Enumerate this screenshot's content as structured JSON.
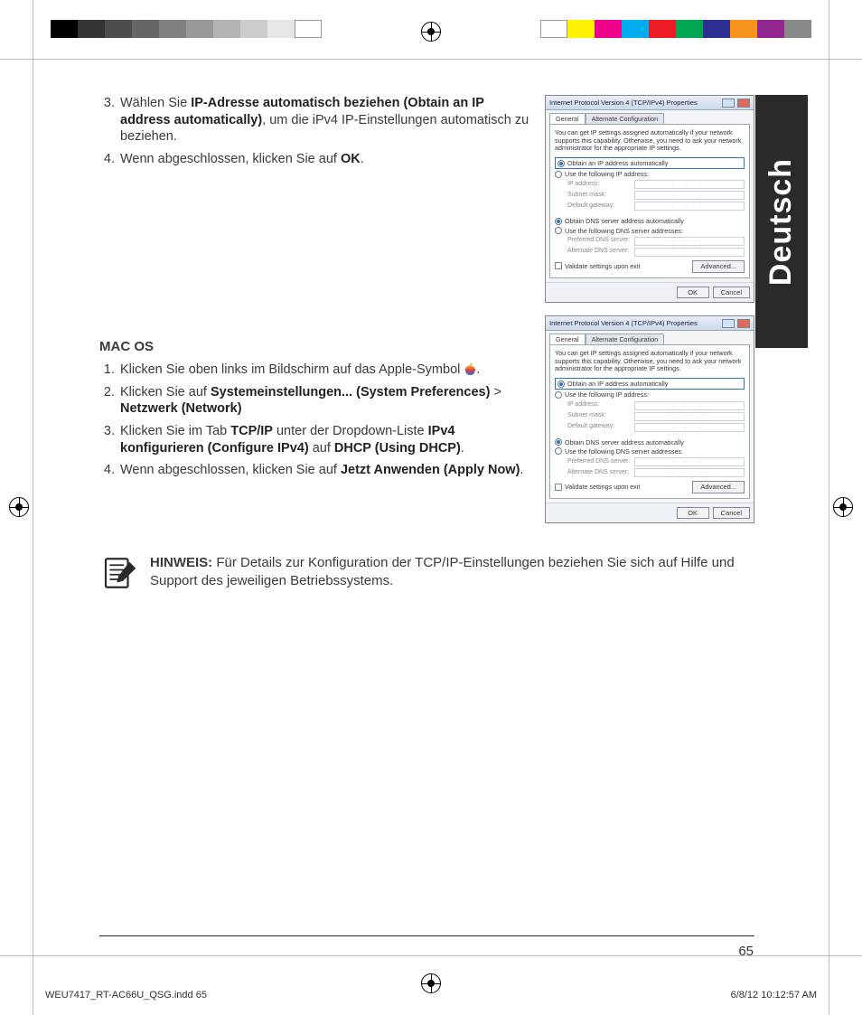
{
  "language_tab": "Deutsch",
  "page_number": "65",
  "slug": {
    "file": "WEU7417_RT-AC66U_QSG.indd   65",
    "date": "6/8/12   10:12:57 AM"
  },
  "win_steps": [
    {
      "num": "3.",
      "segments": [
        {
          "t": "Wählen Sie "
        },
        {
          "t": "IP-Adresse automatisch beziehen (Obtain an IP address automatically)",
          "b": true
        },
        {
          "t": ", um die iPv4 IP-Einstellungen automatisch zu beziehen."
        }
      ]
    },
    {
      "num": "4.",
      "segments": [
        {
          "t": "Wenn abgeschlossen, klicken Sie auf "
        },
        {
          "t": "OK",
          "b": true
        },
        {
          "t": "."
        }
      ]
    }
  ],
  "mac_heading": "MAC OS",
  "mac_steps": [
    {
      "num": "1.",
      "segments": [
        {
          "t": "Klicken Sie oben links im Bildschirm auf das Apple-Symbol "
        },
        {
          "apple": true
        },
        {
          "t": "."
        }
      ]
    },
    {
      "num": "2.",
      "segments": [
        {
          "t": "Klicken Sie auf "
        },
        {
          "t": "Systemeinstellungen... (System Preferences)",
          "b": true
        },
        {
          "t": " > "
        },
        {
          "t": "Netzwerk (Network)",
          "b": true
        }
      ]
    },
    {
      "num": "3.",
      "segments": [
        {
          "t": "Klicken Sie im Tab "
        },
        {
          "t": "TCP/IP",
          "b": true
        },
        {
          "t": " unter der Dropdown-Liste "
        },
        {
          "t": "IPv4 konfigurieren (Configure IPv4)",
          "b": true
        },
        {
          "t": " auf "
        },
        {
          "t": "DHCP (Using DHCP)",
          "b": true
        },
        {
          "t": "."
        }
      ]
    },
    {
      "num": "4.",
      "segments": [
        {
          "t": "Wenn abgeschlossen, klicken Sie auf "
        },
        {
          "t": "Jetzt Anwenden (Apply Now)",
          "b": true
        },
        {
          "t": "."
        }
      ]
    }
  ],
  "note": {
    "label": "HINWEIS:",
    "text": "  Für Details zur Konfiguration der TCP/IP-Einstellungen beziehen Sie sich auf Hilfe und Support des jeweiligen Betriebssystems."
  },
  "dialog": {
    "title": "Internet Protocol Version 4 (TCP/IPv4) Properties",
    "tabs": [
      "General",
      "Alternate Configuration"
    ],
    "desc": "You can get IP settings assigned automatically if your network supports this capability. Otherwise, you need to ask your network administrator for the appropriate IP settings.",
    "opt_auto_ip": "Obtain an IP address automatically",
    "opt_use_ip": "Use the following IP address:",
    "fields_ip": [
      "IP address:",
      "Subnet mask:",
      "Default gateway:"
    ],
    "opt_auto_dns": "Obtain DNS server address automatically",
    "opt_use_dns": "Use the following DNS server addresses:",
    "fields_dns": [
      "Preferred DNS server:",
      "Alternate DNS server:"
    ],
    "chk_validate": "Validate settings upon exit",
    "btn_adv": "Advanced...",
    "btn_ok": "OK",
    "btn_cancel": "Cancel"
  },
  "colorbar_left": [
    "#000000",
    "#333333",
    "#4d4d4d",
    "#666666",
    "#808080",
    "#999999",
    "#b3b3b3",
    "#cccccc",
    "#e6e6e6",
    "#ffffff"
  ],
  "colorbar_right": [
    "#ffffff",
    "#fff200",
    "#ec008c",
    "#00aeef",
    "#ec1c24",
    "#00a651",
    "#2e3192",
    "#f7941d",
    "#91278f",
    "#898989"
  ]
}
